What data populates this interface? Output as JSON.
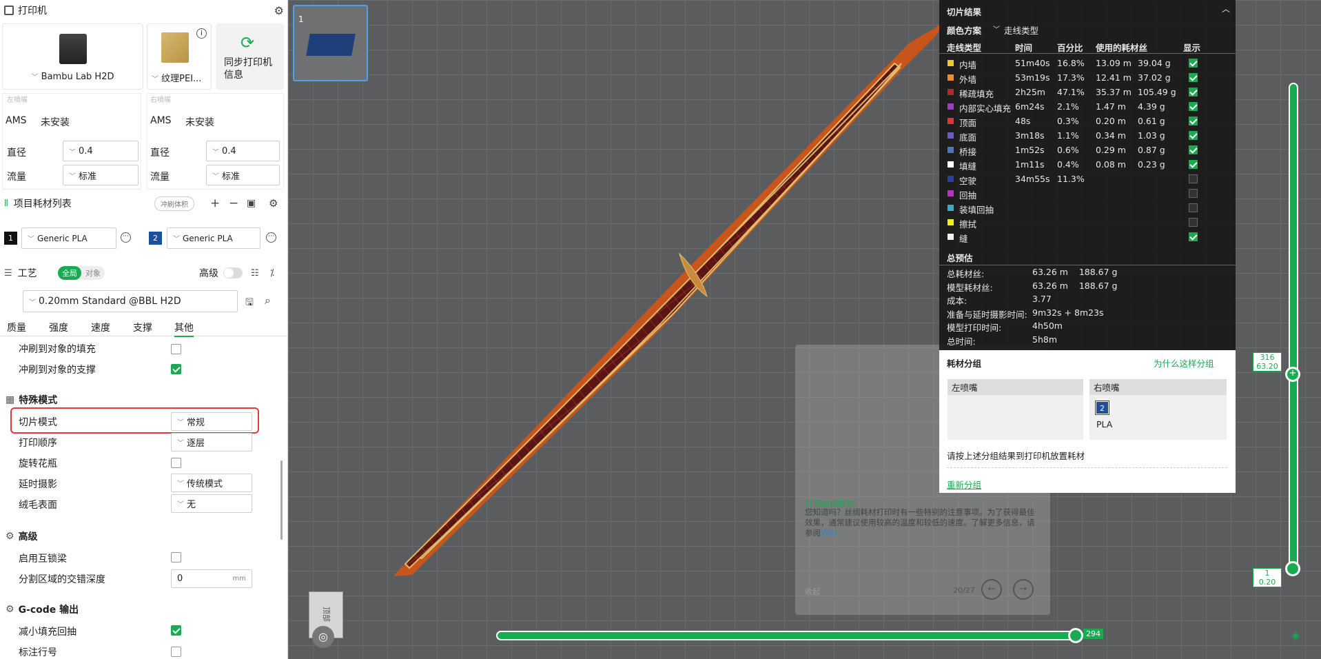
{
  "printer": {
    "title": "打印机",
    "model": "Bambu Lab H2D",
    "plate": "纹理PEI...",
    "sync_label": "同步打印机信息"
  },
  "nozzles": [
    {
      "header": "左喷嘴",
      "ams_label": "AMS",
      "ams_value": "未安装",
      "dia_label": "直径",
      "dia_value": "0.4",
      "flow_label": "流量",
      "flow_value": "标准"
    },
    {
      "header": "右喷嘴",
      "ams_label": "AMS",
      "ams_value": "未安装",
      "dia_label": "直径",
      "dia_value": "0.4",
      "flow_label": "流量",
      "flow_value": "标准"
    }
  ],
  "filaments": {
    "title": "项目耗材列表",
    "flush_label": "冲刷体积",
    "items": [
      {
        "num": "1",
        "name": "Generic PLA",
        "color": "#111111"
      },
      {
        "num": "2",
        "name": "Generic PLA",
        "color": "#1d4f9a"
      }
    ]
  },
  "process": {
    "title": "工艺",
    "toggle_global": "全局",
    "toggle_object": "对象",
    "advanced_label": "高级",
    "preset": "0.20mm Standard @BBL H2D",
    "tabs": [
      "质量",
      "强度",
      "速度",
      "支撑",
      "其他"
    ],
    "active_tab": 4
  },
  "settings": {
    "flush_infill": "冲刷到对象的填充",
    "flush_support": "冲刷到对象的支撑",
    "special_title": "特殊模式",
    "slice_mode_label": "切片模式",
    "slice_mode_value": "常规",
    "print_seq_label": "打印顺序",
    "print_seq_value": "逐层",
    "spiral_label": "旋转花瓶",
    "timelapse_label": "延时摄影",
    "timelapse_value": "传统模式",
    "fuzzy_label": "绒毛表面",
    "fuzzy_value": "无",
    "advanced_title": "高级",
    "interlock_label": "启用互锁梁",
    "interlock_depth_label": "分割区域的交错深度",
    "interlock_depth_value": "0",
    "interlock_unit": "mm",
    "gcode_title": "G-code 输出",
    "reduce_retract_label": "减小填充回抽",
    "label_lines_label": "标注行号"
  },
  "viewport": {
    "plate_num": "1",
    "layer_top": "316",
    "layer_top_h": "63.20",
    "layer_bot": "1",
    "layer_bot_h": "0.20",
    "move_value": "294",
    "cube_face": "顶部",
    "tip_title": "打印丝绸耗材",
    "tip_body": "您知道吗？丝绸耗材打印时有一些特别的注意事项。为了获得最佳效果，通常建议使用较高的温度和较低的速度。了解更多信息，请参阅",
    "tip_link": "Wiki",
    "tip_collapse": "收起",
    "tip_page": "20/27"
  },
  "results": {
    "title": "切片结果",
    "scheme_label": "颜色方案",
    "scheme_value": "走线类型",
    "headers": [
      "走线类型",
      "时间",
      "百分比",
      "使用的耗材丝",
      "显示"
    ],
    "rows": [
      {
        "name": "内墙",
        "time": "51m40s",
        "pct": "16.8%",
        "len": "13.09 m",
        "wt": "39.04 g",
        "color": "#f2c530",
        "shown": true
      },
      {
        "name": "外墙",
        "time": "53m19s",
        "pct": "17.3%",
        "len": "12.41 m",
        "wt": "37.02 g",
        "color": "#f08a30",
        "shown": true
      },
      {
        "name": "稀疏填充",
        "time": "2h25m",
        "pct": "47.1%",
        "len": "35.37 m",
        "wt": "105.49 g",
        "color": "#b02a2a",
        "shown": true
      },
      {
        "name": "内部实心填充",
        "time": "6m24s",
        "pct": "2.1%",
        "len": "1.47 m",
        "wt": "4.39 g",
        "color": "#9a3fc0",
        "shown": true
      },
      {
        "name": "顶面",
        "time": "48s",
        "pct": "0.3%",
        "len": "0.20 m",
        "wt": "0.61 g",
        "color": "#e03535",
        "shown": true
      },
      {
        "name": "底面",
        "time": "3m18s",
        "pct": "1.1%",
        "len": "0.34 m",
        "wt": "1.03 g",
        "color": "#6a5fc0",
        "shown": true
      },
      {
        "name": "桥接",
        "time": "1m52s",
        "pct": "0.6%",
        "len": "0.29 m",
        "wt": "0.87 g",
        "color": "#4a78c0",
        "shown": true
      },
      {
        "name": "填缝",
        "time": "1m11s",
        "pct": "0.4%",
        "len": "0.08 m",
        "wt": "0.23 g",
        "color": "#ffffff",
        "shown": true
      },
      {
        "name": "空驶",
        "time": "34m55s",
        "pct": "11.3%",
        "len": "",
        "wt": "",
        "color": "#2a3fa0",
        "shown": false
      },
      {
        "name": "回抽",
        "time": "",
        "pct": "",
        "len": "",
        "wt": "",
        "color": "#c030c0",
        "shown": false
      },
      {
        "name": "装填回抽",
        "time": "",
        "pct": "",
        "len": "",
        "wt": "",
        "color": "#30b0c0",
        "shown": false
      },
      {
        "name": "擦拭",
        "time": "",
        "pct": "",
        "len": "",
        "wt": "",
        "color": "#f0f020",
        "shown": false
      },
      {
        "name": "缝",
        "time": "",
        "pct": "",
        "len": "",
        "wt": "",
        "color": "#f0f0f0",
        "shown": true
      }
    ],
    "estimate_title": "总预估",
    "estimates": [
      {
        "k": "总耗材丝:",
        "v": "63.26 m    188.67 g"
      },
      {
        "k": "模型耗材丝:",
        "v": "63.26 m    188.67 g"
      },
      {
        "k": "成本:",
        "v": "3.77"
      },
      {
        "k": "准备与延时摄影时间:",
        "v": "9m32s + 8m23s"
      },
      {
        "k": "模型打印时间:",
        "v": "4h50m"
      },
      {
        "k": "总时间:",
        "v": "5h8m"
      }
    ]
  },
  "grouping": {
    "title": "耗材分组",
    "why": "为什么这样分组",
    "left": "左喷嘴",
    "right": "右喷嘴",
    "right_num": "2",
    "right_mat": "PLA",
    "note": "请按上述分组结果到打印机放置耗材",
    "regroup": "重新分组"
  }
}
